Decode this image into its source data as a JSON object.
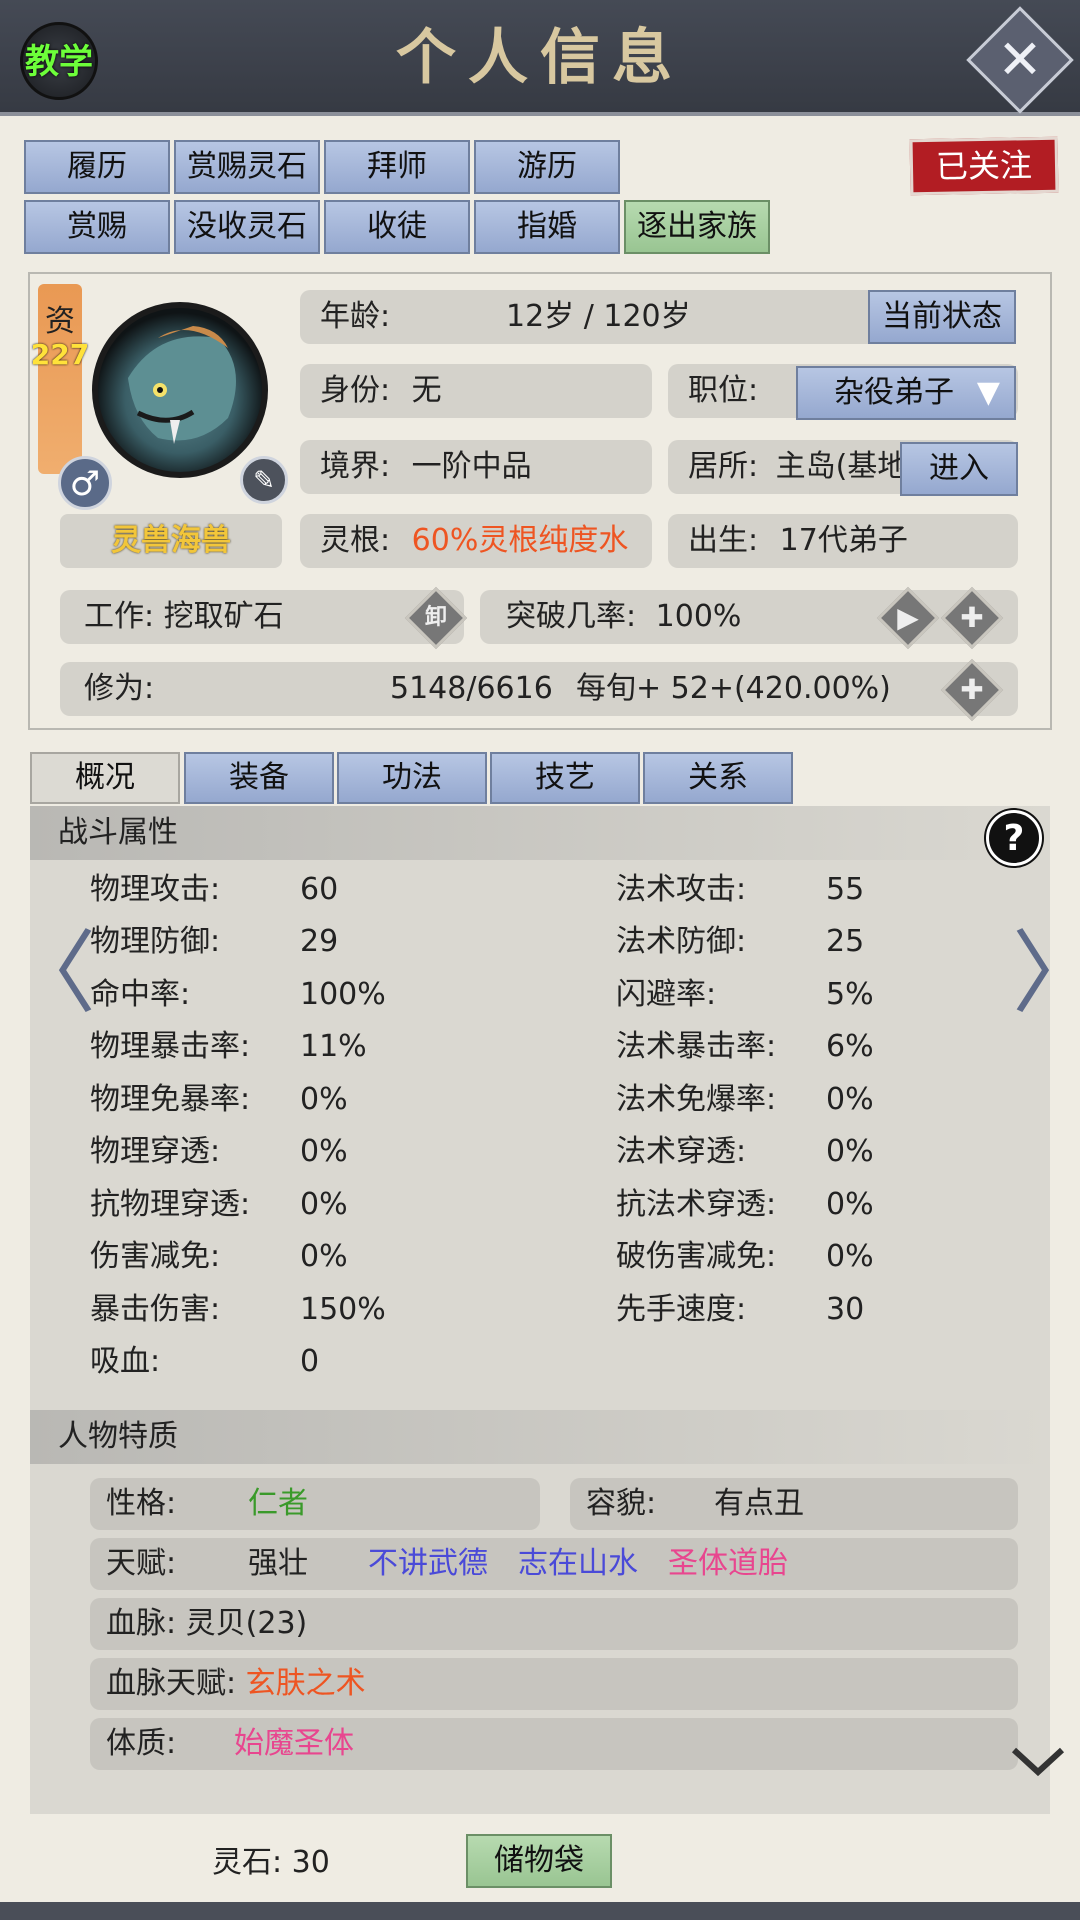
{
  "header": {
    "title": "个人信息",
    "teach": "教学"
  },
  "top_buttons": {
    "row1": [
      "履历",
      "赏赐灵石",
      "拜师",
      "游历"
    ],
    "row2": [
      "赏赐",
      "没收灵石",
      "收徒",
      "指婚",
      "逐出家族"
    ],
    "followed": "已关注"
  },
  "profile": {
    "zi_label": "资",
    "zi_value": "227",
    "species": "灵兽海兽",
    "age_label": "年龄:",
    "age_value": "12岁 / 120岁",
    "current_state": "当前状态",
    "identity_label": "身份:",
    "identity_value": "无",
    "position_label": "职位:",
    "position_value": "杂役弟子",
    "realm_label": "境界:",
    "realm_value": "一阶中品",
    "residence_label": "居所:",
    "residence_value": "主岛(基地",
    "enter": "进入",
    "root_label": "灵根:",
    "root_value": "60%灵根纯度水",
    "birth_label": "出生:",
    "birth_value": "17代弟子",
    "work_label": "工作:",
    "work_value": "挖取矿石",
    "unload": "卸",
    "breakthrough_label": "突破几率:",
    "breakthrough_value": "100%",
    "cultivation_label": "修为:",
    "cultivation_value": "5148/6616",
    "cultivation_rate": "每旬+  52+(420.00%)"
  },
  "tabs": [
    "概况",
    "装备",
    "功法",
    "技艺",
    "关系"
  ],
  "combat": {
    "title": "战斗属性",
    "left": [
      {
        "label": "物理攻击:",
        "value": "60"
      },
      {
        "label": "物理防御:",
        "value": "29"
      },
      {
        "label": "命中率:",
        "value": "100%"
      },
      {
        "label": "物理暴击率:",
        "value": "11%"
      },
      {
        "label": "物理免暴率:",
        "value": "0%"
      },
      {
        "label": "物理穿透:",
        "value": "0%"
      },
      {
        "label": "抗物理穿透:",
        "value": "0%"
      },
      {
        "label": "伤害减免:",
        "value": "0%"
      },
      {
        "label": "暴击伤害:",
        "value": "150%"
      },
      {
        "label": "吸血:",
        "value": "0"
      }
    ],
    "right": [
      {
        "label": "法术攻击:",
        "value": "55"
      },
      {
        "label": "法术防御:",
        "value": "25"
      },
      {
        "label": "闪避率:",
        "value": "5%"
      },
      {
        "label": "法术暴击率:",
        "value": "6%"
      },
      {
        "label": "法术免爆率:",
        "value": "0%"
      },
      {
        "label": "法术穿透:",
        "value": "0%"
      },
      {
        "label": "抗法术穿透:",
        "value": "0%"
      },
      {
        "label": "破伤害减免:",
        "value": "0%"
      },
      {
        "label": "先手速度:",
        "value": "30"
      }
    ]
  },
  "traits": {
    "title": "人物特质",
    "personality_label": "性格:",
    "personality_value": "仁者",
    "appearance_label": "容貌:",
    "appearance_value": "有点丑",
    "talent_label": "天赋:",
    "talents": [
      "强壮",
      "不讲武德",
      "志在山水",
      "圣体道胎"
    ],
    "bloodline_label": "血脉:",
    "bloodline_value": "灵贝(23)",
    "bloodline_talent_label": "血脉天赋:",
    "bloodline_talent_value": "玄肤之术",
    "constitution_label": "体质:",
    "constitution_value": "始魔圣体"
  },
  "bottom": {
    "stone_label": "灵石:",
    "stone_value": "30",
    "bag": "储物袋"
  },
  "colors": {
    "green_text": "#3a9a2a",
    "orange_text": "#ee5522",
    "blue_text": "#4a4ad8",
    "pink_text": "#e8468f"
  }
}
